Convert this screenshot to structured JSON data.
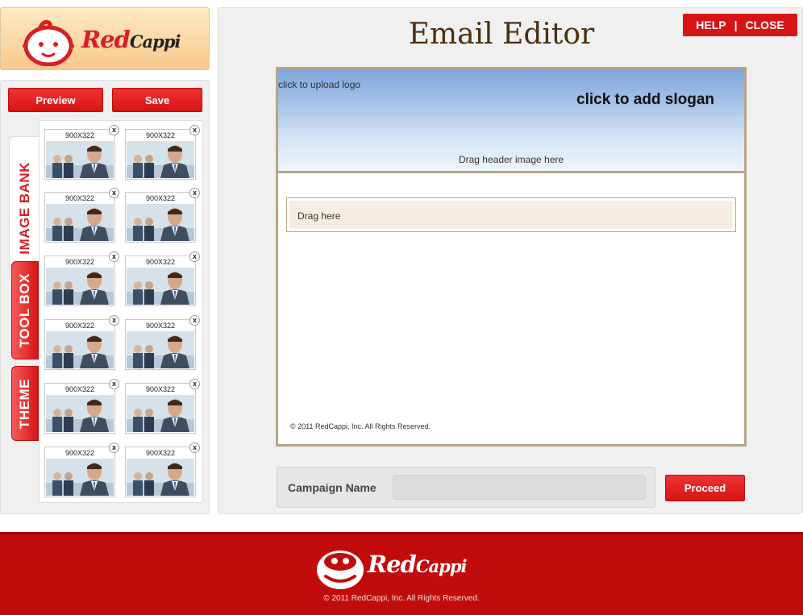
{
  "brand": {
    "name_main": "Red",
    "name_tail": "Cappi",
    "accent": "#d71414"
  },
  "sidebar": {
    "preview_label": "Preview",
    "save_label": "Save",
    "tabs": {
      "image_bank": "IMAGE BANK",
      "tool_box": "TOOL BOX",
      "theme": "THEME"
    },
    "thumb_size_label": "900X322",
    "thumb_close": "x"
  },
  "editor": {
    "title": "Email Editor",
    "help_label": "HELP",
    "separator": "|",
    "close_label": "CLOSE",
    "upload_logo": "click to upload logo",
    "add_slogan": "click to add slogan",
    "drag_header": "Drag header image here",
    "drag_here": "Drag here",
    "email_copyright": "© 2011 RedCappi, Inc. All Rights Reserved."
  },
  "campaign": {
    "label": "Campaign Name",
    "value": "",
    "placeholder": "",
    "proceed_label": "Proceed"
  },
  "footer": {
    "copyright": "© 2011 RedCappi, Inc. All Rights Reserved."
  }
}
